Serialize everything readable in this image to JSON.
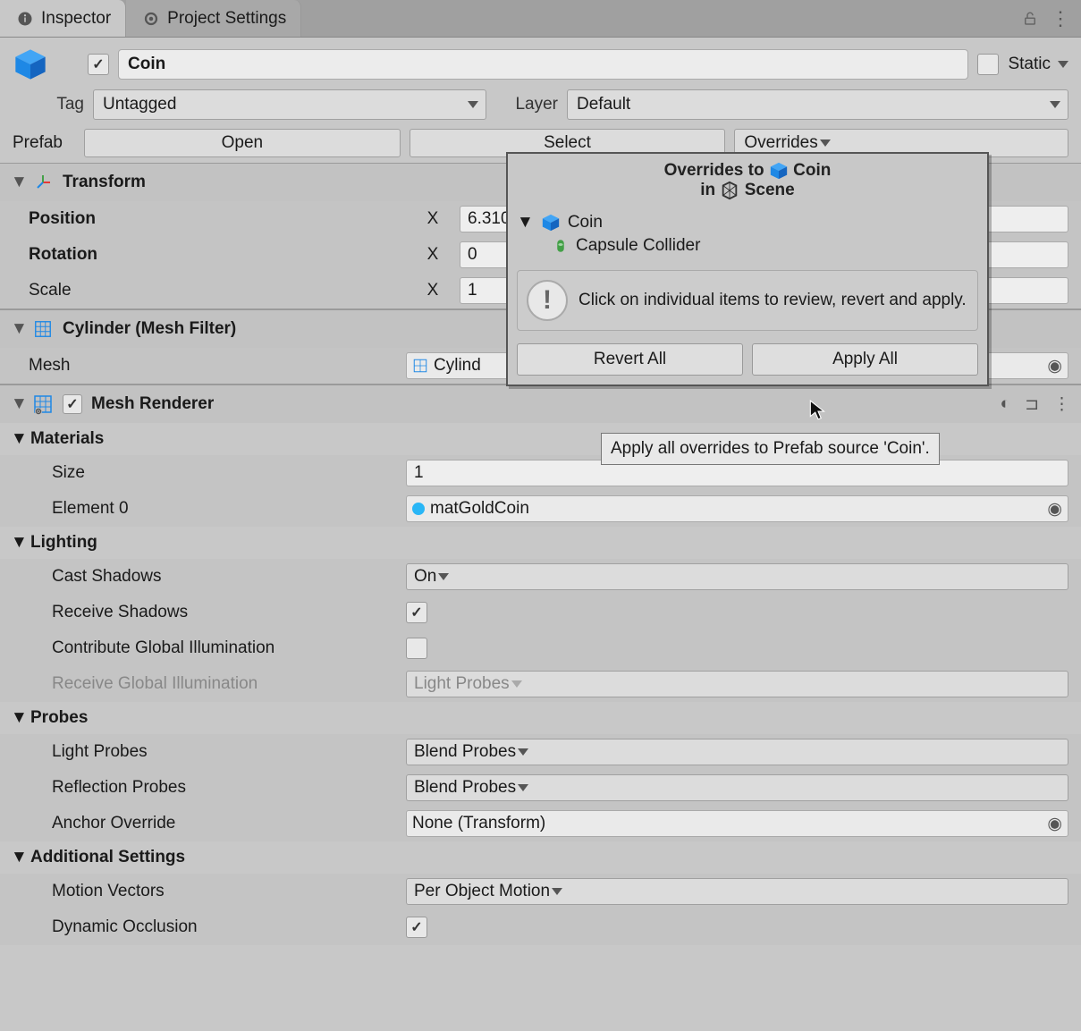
{
  "tabs": {
    "inspector": "Inspector",
    "projectSettings": "Project Settings"
  },
  "gameObject": {
    "name": "Coin",
    "staticLabel": "Static",
    "active": true,
    "static": false
  },
  "tag": {
    "label": "Tag",
    "value": "Untagged"
  },
  "layer": {
    "label": "Layer",
    "value": "Default"
  },
  "prefab": {
    "label": "Prefab",
    "open": "Open",
    "select": "Select",
    "overrides": "Overrides"
  },
  "transform": {
    "title": "Transform",
    "position": {
      "label": "Position",
      "x": "6.3101"
    },
    "rotation": {
      "label": "Rotation",
      "x": "0"
    },
    "scale": {
      "label": "Scale",
      "x": "1"
    }
  },
  "meshFilter": {
    "title": "Cylinder (Mesh Filter)",
    "meshLabel": "Mesh",
    "meshValue": "Cylind"
  },
  "meshRenderer": {
    "title": "Mesh Renderer"
  },
  "materials": {
    "title": "Materials",
    "size": {
      "label": "Size",
      "value": "1"
    },
    "element0": {
      "label": "Element 0",
      "value": "matGoldCoin"
    }
  },
  "lighting": {
    "title": "Lighting",
    "castShadows": {
      "label": "Cast Shadows",
      "value": "On"
    },
    "receiveShadows": {
      "label": "Receive Shadows",
      "value": true
    },
    "contributeGI": {
      "label": "Contribute Global Illumination",
      "value": false
    },
    "receiveGI": {
      "label": "Receive Global Illumination",
      "value": "Light Probes"
    }
  },
  "probes": {
    "title": "Probes",
    "lightProbes": {
      "label": "Light Probes",
      "value": "Blend Probes"
    },
    "reflectionProbes": {
      "label": "Reflection Probes",
      "value": "Blend Probes"
    },
    "anchorOverride": {
      "label": "Anchor Override",
      "value": "None (Transform)"
    }
  },
  "additional": {
    "title": "Additional Settings",
    "motionVectors": {
      "label": "Motion Vectors",
      "value": "Per Object Motion"
    },
    "dynamicOcclusion": {
      "label": "Dynamic Occlusion",
      "value": true
    }
  },
  "popup": {
    "overridesTo": "Overrides to",
    "target": "Coin",
    "in": "in",
    "scene": "Scene",
    "root": "Coin",
    "child": "Capsule Collider",
    "hint": "Click on individual items to review, revert and apply.",
    "revertAll": "Revert All",
    "applyAll": "Apply All"
  },
  "tooltip": "Apply all overrides to Prefab source 'Coin'."
}
